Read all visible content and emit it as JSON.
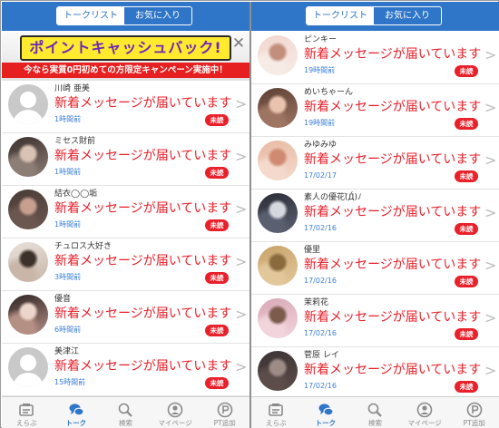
{
  "segment": {
    "tab_list": "トークリスト",
    "tab_fav": "お気に入り"
  },
  "banner": {
    "title": "ポイントキャッシュバック!",
    "subtitle": "今なら実質0円初めての方限定キャンペーン実施中！",
    "close_symbol": "✕"
  },
  "unread_label": "未読",
  "chevron_symbol": ">",
  "left_list": [
    {
      "name": "川崎 亜美",
      "message": "新着メッセージが届いています",
      "time": "1時間前",
      "avatar": "placeholder"
    },
    {
      "name": "ミセス財前",
      "message": "新着メッセージが届いています",
      "time": "1時間前",
      "avatar": "photo",
      "colors": [
        "#3a2f2c",
        "#d9c2b4",
        "#8c7d75"
      ]
    },
    {
      "name": "結衣◯◯垢",
      "message": "新着メッセージが届いています",
      "time": "1時間前",
      "avatar": "photo",
      "colors": [
        "#4a3b36",
        "#c79f8e",
        "#6b5750"
      ]
    },
    {
      "name": "チュロス大好き",
      "message": "新着メッセージが届いています",
      "time": "3時間前",
      "avatar": "photo",
      "colors": [
        "#e8e2dc",
        "#3d312b",
        "#c9b6a8"
      ]
    },
    {
      "name": "優音",
      "message": "新着メッセージが届いています",
      "time": "6時間前",
      "avatar": "photo",
      "colors": [
        "#2e2424",
        "#ecd5cb",
        "#b48f84"
      ]
    },
    {
      "name": "美津江",
      "message": "新着メッセージが届いています",
      "time": "15時間前",
      "avatar": "placeholder"
    }
  ],
  "right_list": [
    {
      "name": "ピンキー",
      "message": "新着メッセージが届いています",
      "time": "19時間前",
      "avatar": "photo",
      "colors": [
        "#f2d6ce",
        "#c28f7d",
        "#f7ebe6"
      ]
    },
    {
      "name": "めいちゃーん",
      "message": "新着メッセージが届いています",
      "time": "19時間前",
      "avatar": "photo",
      "colors": [
        "#5b3f33",
        "#e9c3ad",
        "#9e7462"
      ]
    },
    {
      "name": "みゆみゆ",
      "message": "新着メッセージが届いています",
      "time": "17/02/17",
      "avatar": "photo",
      "colors": [
        "#e8b9a3",
        "#d08a72",
        "#f4d9cc"
      ]
    },
    {
      "name": "素人の優花(̀Д́)ﾉ",
      "message": "新着メッセージが届いています",
      "time": "17/02/16",
      "avatar": "photo",
      "colors": [
        "#2a2c36",
        "#d6d8df",
        "#5b6070"
      ]
    },
    {
      "name": "優里",
      "message": "新着メッセージが届いています",
      "time": "17/02/16",
      "avatar": "photo",
      "colors": [
        "#c9a36a",
        "#8a6b3e",
        "#e2c79b"
      ]
    },
    {
      "name": "茉莉花",
      "message": "新着メッセージが届いています",
      "time": "17/02/16",
      "avatar": "photo",
      "colors": [
        "#d9a7b6",
        "#7d5b4c",
        "#f1d4dc"
      ]
    },
    {
      "name": "菅原 レイ",
      "message": "新着メッセージが届いています",
      "time": "17/02/16",
      "avatar": "photo",
      "colors": [
        "#3b3333",
        "#9d8b86",
        "#5c4c4a"
      ]
    }
  ],
  "tabbar": [
    {
      "label": "えらぶ",
      "icon": "select-icon",
      "active": false
    },
    {
      "label": "トーク",
      "icon": "chat-icon",
      "active": true
    },
    {
      "label": "検索",
      "icon": "search-icon",
      "active": false
    },
    {
      "label": "マイページ",
      "icon": "mypage-icon",
      "active": false
    },
    {
      "label": "PT追加",
      "icon": "points-icon",
      "active": false
    }
  ],
  "colors": {
    "accent": "#2f75c8",
    "unread": "#e8202a",
    "time": "#3a7ed8",
    "inactive": "#8a8a8a"
  }
}
